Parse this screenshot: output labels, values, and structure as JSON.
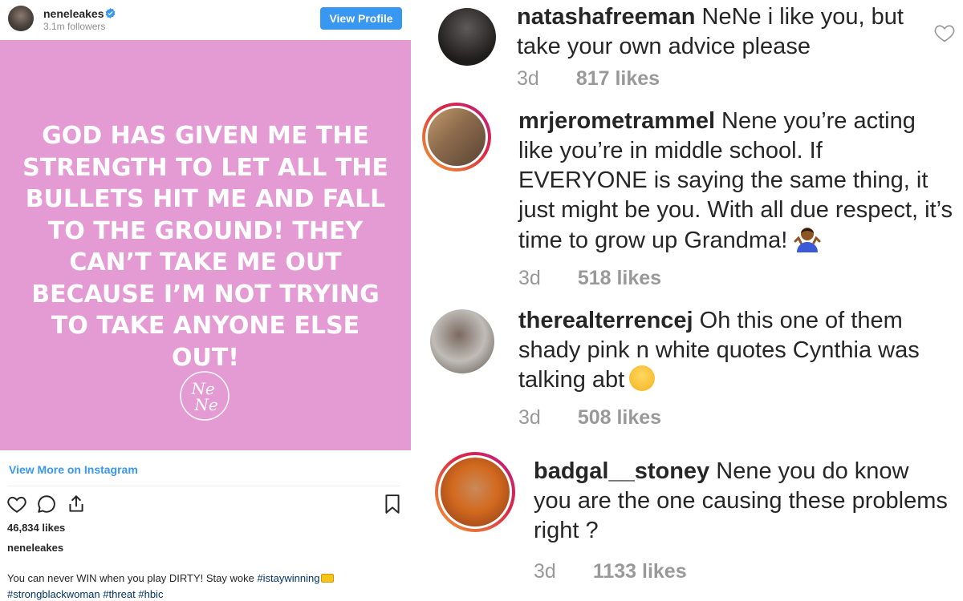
{
  "post": {
    "username": "neneleakes",
    "followers": "3.1m followers",
    "view_profile_label": "View Profile",
    "quote_lines": [
      "GOD HAS GIVEN ME THE",
      "STRENGTH TO LET ALL THE",
      "BULLETS HIT ME AND FALL",
      "TO THE GROUND! THEY",
      "CAN’T TAKE ME OUT",
      "BECAUSE I’M NOT TRYING",
      "TO TAKE ANYONE ELSE OUT!"
    ],
    "logo_text": "NeNe",
    "view_more_label": "View More on Instagram",
    "likes": "46,834 likes",
    "caption_user": "neneleakes",
    "caption_text": "You can never WIN when you play DIRTY! Stay woke ",
    "caption_tags": [
      "#istaywinning",
      "#strongblackwoman",
      "#threat",
      "#hbic"
    ],
    "colors": {
      "post_bg": "#e49ad3",
      "link": "#3897f0"
    }
  },
  "comments": [
    {
      "user": "natashafreeman",
      "text": " NeNe i like you, but take your own advice please",
      "age": "3d",
      "likes": "817 likes",
      "ring": false
    },
    {
      "user": "mrjerometrammel",
      "text": " Nene you’re acting like you’re in middle school. If EVERYONE is saying the same thing, it just might be you. With all due respect, it’s time to grow up Grandma!",
      "age": "3d",
      "likes": "518 likes",
      "ring": true,
      "emoji": "person-shrugging-emoji"
    },
    {
      "user": "therealterrencej",
      "text": " Oh this one of them shady pink n white quotes Cynthia was talking abt",
      "age": "3d",
      "likes": "508 likes",
      "ring": false,
      "emoji": "weary-face-emoji"
    },
    {
      "user": "badgal__stoney",
      "text": " Nene you do know you are the one causing these problems right ?",
      "age": "3d",
      "likes": "1133 likes",
      "ring": true
    }
  ]
}
